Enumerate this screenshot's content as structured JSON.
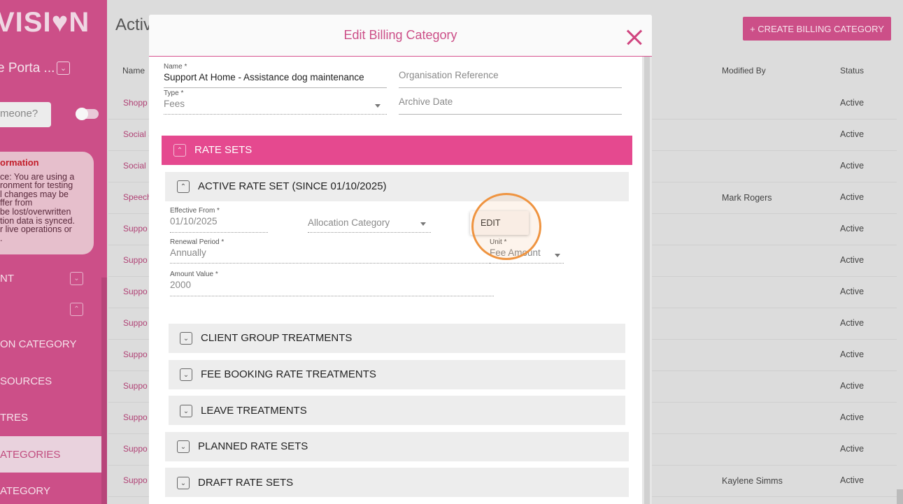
{
  "sidebar": {
    "logo": "VISI♥N",
    "portal_name": "e Porta ...",
    "search_placeholder": "meone?",
    "info": {
      "title": "ormation",
      "lines": [
        "ce: You are using a",
        "ronment for testing",
        "l changes may be",
        "ffer from",
        "be lost/overwritten",
        "tion data is synced.",
        "r live operations or",
        "."
      ]
    },
    "nav_items": [
      {
        "label": "NT",
        "chevron": true
      },
      {
        "label": "",
        "chevron": true
      },
      {
        "label": "ON CATEGORY",
        "chevron": false
      },
      {
        "label": "SOURCES",
        "chevron": false
      },
      {
        "label": "TRES",
        "chevron": false
      },
      {
        "label": "ATEGORIES",
        "chevron": false,
        "active": true
      },
      {
        "label": "ATEGORY",
        "chevron": false
      }
    ]
  },
  "page": {
    "title": "Activ",
    "create_button": "+ CREATE BILLING CATEGORY",
    "columns": {
      "name": "Name",
      "modified_by": "Modified By",
      "status": "Status"
    },
    "rows": [
      {
        "name": "Shopp",
        "modified_by": "",
        "status": "Active"
      },
      {
        "name": "Social S",
        "modified_by": "",
        "status": "Active"
      },
      {
        "name": "Social",
        "modified_by": "",
        "status": "Active"
      },
      {
        "name": "Speech",
        "modified_by": "Mark Rogers",
        "status": "Active"
      },
      {
        "name": "Suppo",
        "modified_by": "",
        "status": "Active"
      },
      {
        "name": "Suppo",
        "modified_by": "",
        "status": "Active"
      },
      {
        "name": "Suppo",
        "modified_by": "",
        "status": "Active"
      },
      {
        "name": "Suppo",
        "modified_by": "",
        "status": "Active"
      },
      {
        "name": "Suppo",
        "modified_by": "",
        "status": "Active"
      },
      {
        "name": "Suppo",
        "modified_by": "",
        "status": "Active"
      },
      {
        "name": "Suppo",
        "modified_by": "",
        "status": "Active"
      },
      {
        "name": "Suppo",
        "modified_by": "",
        "status": "Active"
      },
      {
        "name": "Suppo",
        "modified_by": "Kaylene Simms",
        "status": "Active"
      }
    ]
  },
  "modal": {
    "title": "Edit Billing Category",
    "name_label": "Name *",
    "name_value": "Support At Home - Assistance dog maintenance",
    "org_ref_placeholder": "Organisation Reference",
    "type_label": "Type *",
    "type_value": "Fees",
    "archive_date_placeholder": "Archive Date",
    "rate_sets_label": "RATE SETS",
    "active_rate_set_label": "ACTIVE RATE SET (SINCE 01/10/2025)",
    "effective_from_label": "Effective From *",
    "effective_from_value": "01/10/2025",
    "allocation_category_placeholder": "Allocation Category",
    "edit_button": "EDIT",
    "renewal_period_label": "Renewal Period *",
    "renewal_period_value": "Annually",
    "unit_label": "Unit *",
    "unit_value": "Fee Amount",
    "amount_value_label": "Amount Value *",
    "amount_value": "2000",
    "sub_sections": [
      "CLIENT GROUP TREATMENTS",
      "FEE BOOKING RATE TREATMENTS",
      "LEAVE TREATMENTS"
    ],
    "planned_rate_sets": "PLANNED RATE SETS",
    "draft_rate_sets": "DRAFT RATE SETS"
  },
  "colors": {
    "brand": "#cc4f88",
    "accent": "#e5498f",
    "highlight": "#ef9440"
  }
}
